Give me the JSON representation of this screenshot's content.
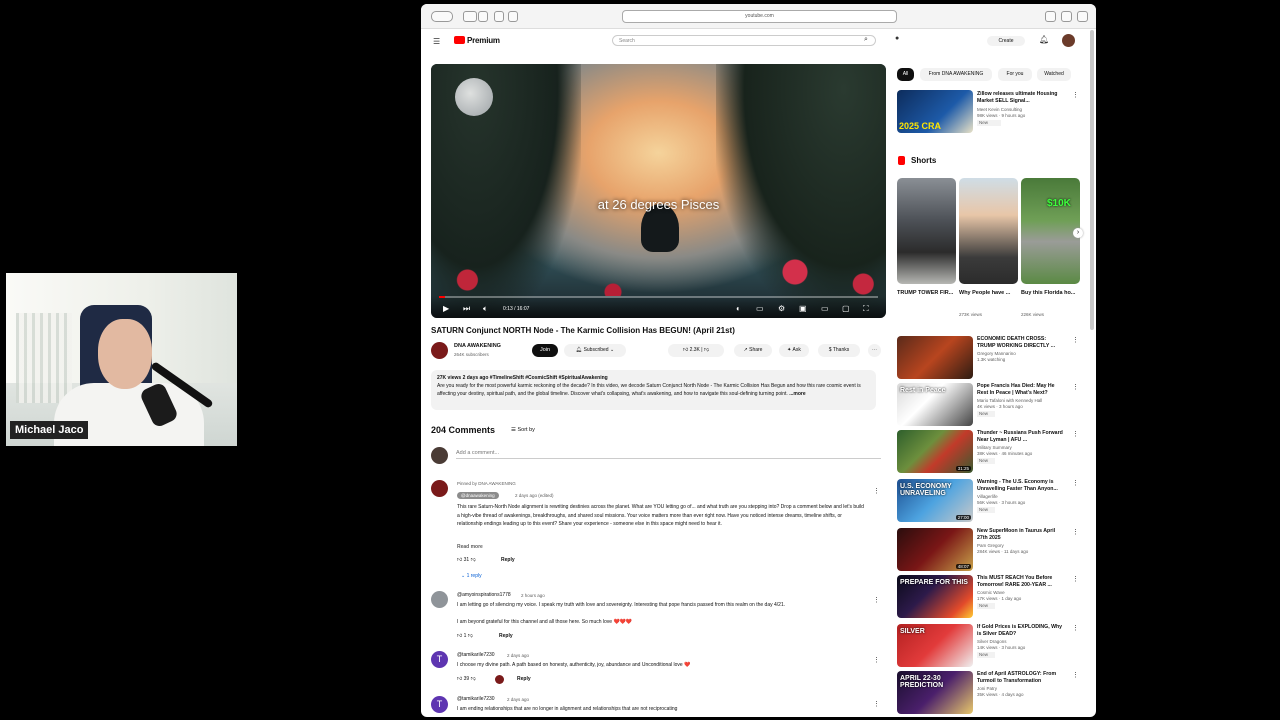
{
  "webcam": {
    "name": "Michael Jaco"
  },
  "browser": {
    "url": "youtube.com"
  },
  "header": {
    "logo": "Premium",
    "search_placeholder": "Search",
    "create": "Create"
  },
  "player": {
    "caption": "at 26 degrees Pisces",
    "time": "0:13 / 16:07",
    "progress": 0.014
  },
  "video": {
    "title": "SATURN Conjunct NORTH Node - The Karmic Collision Has BEGUN! (April 21st)",
    "channel": "DNA AWAKENING",
    "subscribers": "264K subscribers",
    "join": "Join",
    "subscribed": "Subscribed",
    "likes": "2.3K",
    "share": "Share",
    "ask": "Ask",
    "thanks": "Thanks",
    "desc_meta": "27K views  2 days ago  #TimelineShift #CosmicShift #SpiritualAwakening",
    "desc_text": "Are you ready for the most powerful karmic reckoning of the decade? In this video, we decode Saturn Conjunct North Node - The Karmic Collision Has Begun and how this rare cosmic event is affecting your destiny, spiritual path, and the global timeline. Discover what's collapsing, what's awakening, and how to navigate this soul-defining turning point.",
    "desc_more": "...more"
  },
  "comments": {
    "count": "204 Comments",
    "sort": "Sort by",
    "add_placeholder": "Add a comment...",
    "items": [
      {
        "pinned": "Pinned by DNA AWAKENING",
        "author": "@dnaawakening",
        "time": "2 days ago (edited)",
        "text": "This rare Saturn-North Node alignment is rewriting destinies across the planet. What are YOU letting go of... and what truth are you stepping into? Drop a comment below and let's build a high-vibe thread of awakenings, breakthroughs, and shared soul missions. Your voice matters more than ever right now. Have you noticed intense dreams, timeline shifts, or relationship endings leading up to this event? Share your experience - someone else in this space might need to hear it.",
        "read_more": "Read more",
        "likes": "31",
        "reply": "Reply",
        "replies": "1 reply"
      },
      {
        "author": "@amyoinspirations1778",
        "time": "2 hours ago",
        "text": "I am letting go of silencing my voice. I speak my truth with love and sovereignty. Interesting that pope francis passed from this realm on the day 4/21.",
        "text2": "I am beyond grateful for this channel and all those here. So much love ❤️❤️❤️",
        "likes": "1",
        "reply": "Reply"
      },
      {
        "author": "@tamikarile7230",
        "time": "2 days ago",
        "text": "I choose my divine path. A path based on honesty, authenticity, joy, abundance and Unconditional love ❤️",
        "likes": "39",
        "reply": "Reply"
      },
      {
        "author": "@tamikarile7230",
        "time": "2 days ago",
        "text": "I am ending relationships that are no longer in alignment and relationships that are not reciprocating"
      }
    ]
  },
  "sidebar": {
    "chips": [
      "All",
      "From DNA AWAKENING",
      "For you",
      "Watched"
    ],
    "top_video": {
      "title": "Zillow releases ultimate Housing Market SELL Signal...",
      "channel": "Meet Kevin Consulting",
      "meta": "98K views · 9 hours ago",
      "badge": "New",
      "thumb_text": "2025 CRA"
    },
    "shorts_heading": "Shorts",
    "shorts": [
      {
        "title": "TRUMP TOWER FIR...",
        "views": ""
      },
      {
        "title": "Why People have ...",
        "views": "273K views"
      },
      {
        "title": "Buy this Florida ho...",
        "views": "226K views",
        "badge": "$10K"
      }
    ],
    "videos": [
      {
        "title": "ECONOMIC DEATH CROSS: TRUMP WORKING DIRECTLY ...",
        "channel": "Gregory Mannarino",
        "meta": "1.3K watching",
        "thumb_text": "",
        "duration": ""
      },
      {
        "title": "Pope Francis Has Died: May He Rest In Peace | What's Next?",
        "channel": "Mario Tafaloni with Kennedy Hall",
        "meta": "4K views · 3 hours ago",
        "badge": "New",
        "thumb_text": "Rest in Peace"
      },
      {
        "title": "Thunder ~ Russians Push Forward Near Lyman | AFU ...",
        "channel": "Military Summary",
        "meta": "38K views · 46 minutes ago",
        "badge": "New",
        "duration": "31:25"
      },
      {
        "title": "Warning - The U.S. Economy is Unravelling Faster Than Anyon...",
        "channel": "Villagerlife",
        "meta": "56K views · 3 hours ago",
        "badge": "New",
        "thumb_text": "U.S. ECONOMY UNRAVELING",
        "duration": "27:00"
      },
      {
        "title": "New SuperMoon in Taurus April 27th 2025",
        "channel": "Pam Gregory",
        "meta": "284K views · 11 days ago",
        "duration": "48:07"
      },
      {
        "title": "This MUST REACH You Before Tomorrow! RARE 200-YEAR ...",
        "channel": "Cosmic Wave",
        "meta": "17K views · 1 day ago",
        "badge": "New",
        "thumb_text": "PREPARE FOR THIS"
      },
      {
        "title": "If Gold Prices is EXPLODING, Why is Silver DEAD?",
        "channel": "Silver Dragons",
        "meta": "14K views · 3 hours ago",
        "badge": "New",
        "thumb_text": "SILVER"
      },
      {
        "title": "End of April ASTROLOGY: From Turmoil to Transformation",
        "channel": "Joni Patry",
        "meta": "35K views · 4 days ago",
        "thumb_text": "APRIL 22-30 PREDICTION"
      }
    ]
  },
  "colors": {
    "youtube_red": "#ff0000",
    "link_blue": "#065fd4",
    "chip_bg": "#f2f2f2"
  }
}
